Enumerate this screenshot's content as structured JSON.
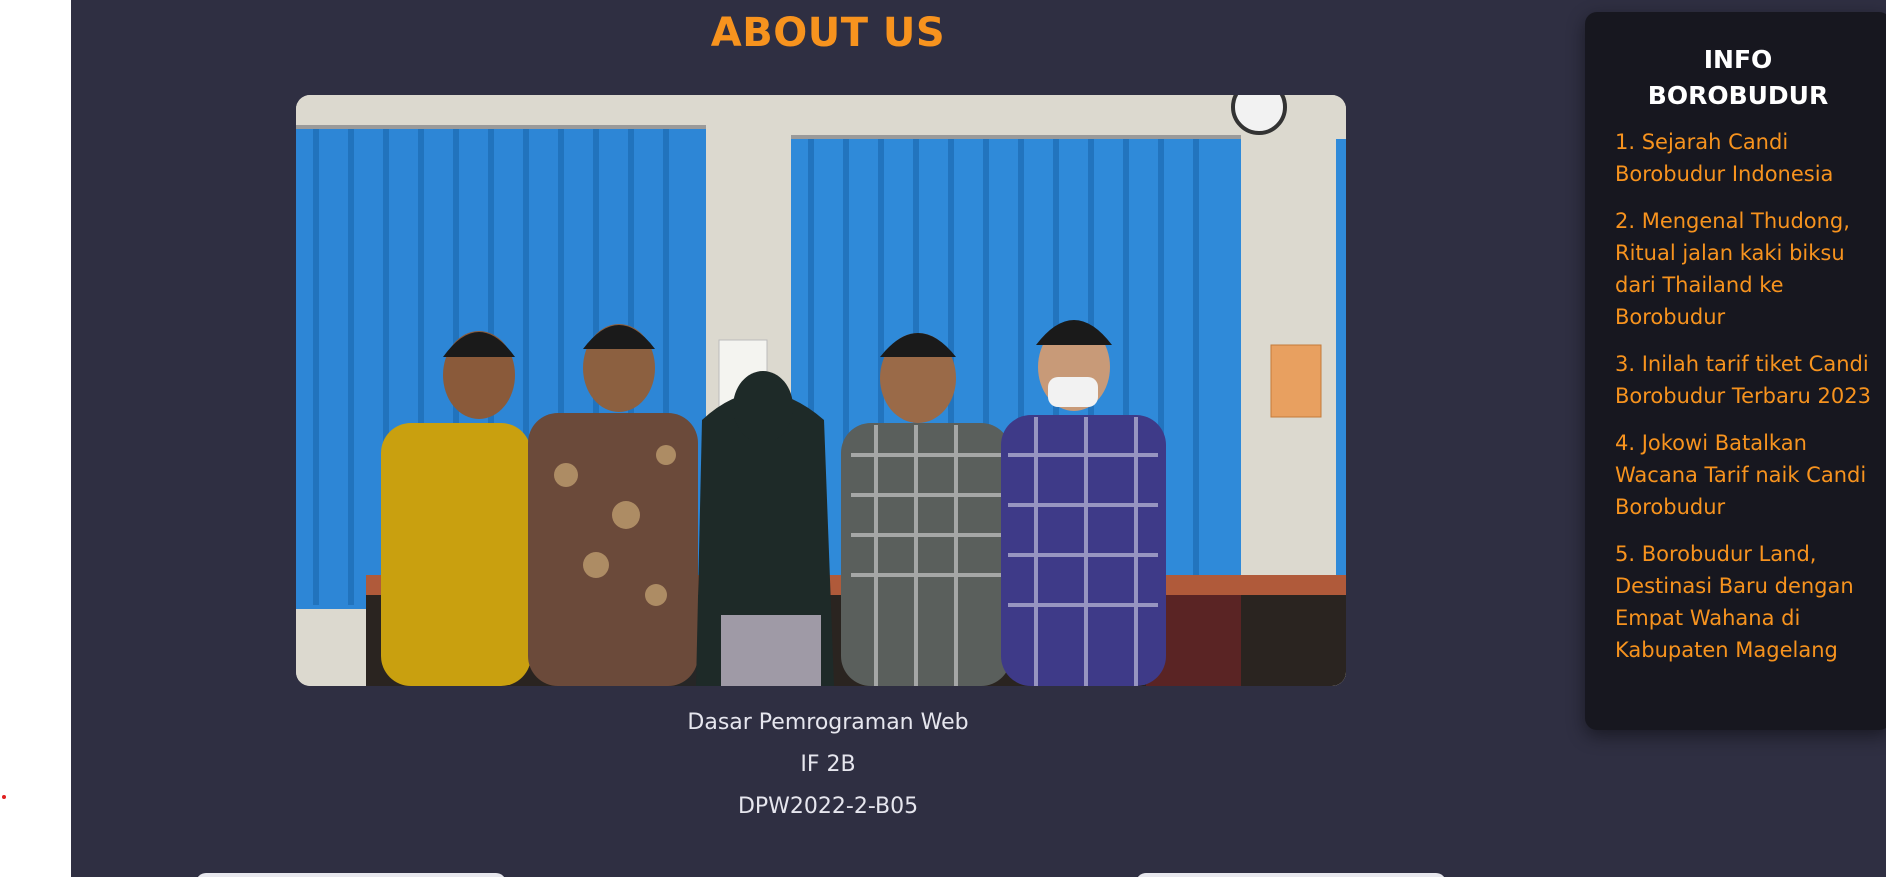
{
  "page": {
    "title": "ABOUT US"
  },
  "photo": {
    "alt": "Group photo of five students standing in front of blue curtains"
  },
  "captions": [
    "Dasar Pemrograman Web",
    "IF 2B",
    "DPW2022-2-B05"
  ],
  "sidebar": {
    "title_line1": "INFO",
    "title_line2": "BOROBUDUR",
    "items": [
      {
        "label": "1. Sejarah Candi Borobudur Indonesia"
      },
      {
        "label": "2. Mengenal Thudong, Ritual jalan kaki biksu dari Thailand ke Borobudur"
      },
      {
        "label": "3. Inilah tarif tiket Candi Borobudur Terbaru 2023"
      },
      {
        "label": "4. Jokowi Batalkan Wacana Tarif naik Candi Borobudur"
      },
      {
        "label": "5. Borobudur Land, Destinasi Baru dengan Empat Wahana di Kabupaten Magelang"
      }
    ]
  },
  "colors": {
    "accent": "#f7931e",
    "background": "#2f2f42",
    "panel": "#17171f",
    "text": "#e6e6ee"
  }
}
